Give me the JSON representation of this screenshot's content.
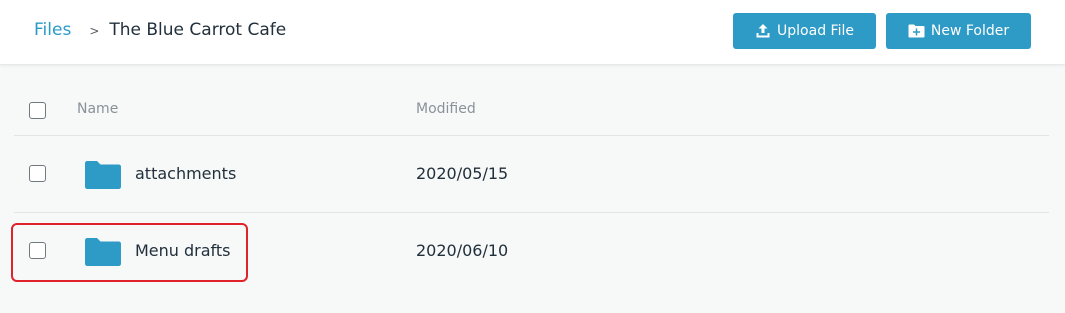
{
  "breadcrumb": {
    "root": "Files",
    "separator": ">",
    "current": "The Blue Carrot Cafe"
  },
  "toolbar": {
    "upload_label": "Upload File",
    "new_folder_label": "New Folder"
  },
  "table": {
    "columns": {
      "name": "Name",
      "modified": "Modified"
    },
    "rows": [
      {
        "name": "attachments",
        "modified": "2020/05/15",
        "icon": "folder-icon"
      },
      {
        "name": "Menu drafts",
        "modified": "2020/06/10",
        "icon": "folder-icon"
      }
    ]
  },
  "colors": {
    "accent": "#2e9ac6",
    "highlight": "#e0222a"
  }
}
